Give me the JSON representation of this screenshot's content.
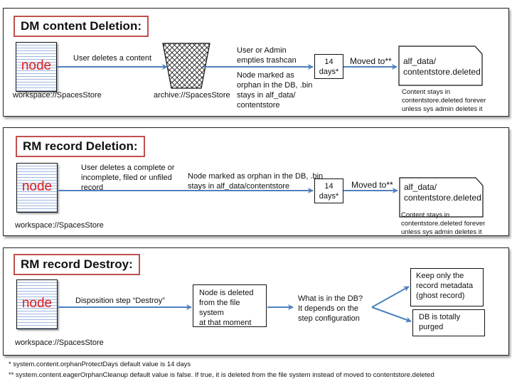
{
  "panels": {
    "dm": {
      "title": "DM content Deletion:",
      "node_label": "node",
      "node_store": "workspace://SpacesStore",
      "step1_label": "User deletes a content",
      "trash_store": "archive://SpacesStore",
      "step2_label_line1": "User or Admin",
      "step2_label_line2": "empties trashcan",
      "note_line1": "Node marked as",
      "note_line2": "orphan in the DB, .bin",
      "note_line3": "stays in alf_data/",
      "note_line4": "contentstore",
      "wait_line1": "14",
      "wait_line2": "days*",
      "moved_label": "Moved to**",
      "dest_line1": "alf_data/",
      "dest_line2": "contentstore.deleted",
      "dest_note_line1": "Content stays in",
      "dest_note_line2": "contentstore.deleted forever",
      "dest_note_line3": "unless sys admin deletes it"
    },
    "rm_delete": {
      "title": "RM record Deletion:",
      "node_label": "node",
      "node_store": "workspace://SpacesStore",
      "step1_line1": "User deletes a complete or",
      "step1_line2": "incomplete, filed or unfiled",
      "step1_line3": "record",
      "note_line1": "Node marked as orphan in the DB, .bin",
      "note_line2": "stays in alf_data/contentstore",
      "wait_line1": "14",
      "wait_line2": "days*",
      "moved_label": "Moved to**",
      "dest_line1": "alf_data/",
      "dest_line2": "contentstore.deleted",
      "dest_note_line1": "Content stays in",
      "dest_note_line2": "contentstore.deleted forever",
      "dest_note_line3": "unless sys admin deletes it"
    },
    "rm_destroy": {
      "title": "RM record Destroy:",
      "node_label": "node",
      "node_store": "workspace://SpacesStore",
      "step1_label": "Disposition step “Destroy”",
      "deleted_line1": "Node is deleted",
      "deleted_line2": "from the file system",
      "deleted_line3": "at that moment",
      "question_line1": "What is in the DB?",
      "question_line2": "It depends on the",
      "question_line3": "step configuration",
      "option1_line1": "Keep only the",
      "option1_line2": "record metadata",
      "option1_line3": "(ghost record)",
      "option2_line1": "DB is totally",
      "option2_line2": "purged"
    }
  },
  "footnotes": {
    "one": "* system.content.orphanProtectDays default value is 14 days",
    "two": "** system.content.eagerOrphanCleanup default value is false. If true, it is deleted from the file system instead of moved to contentstore.deleted"
  },
  "colors": {
    "arrow": "#4f81bd",
    "title_border": "#c0504d",
    "node_text": "#e02020"
  }
}
